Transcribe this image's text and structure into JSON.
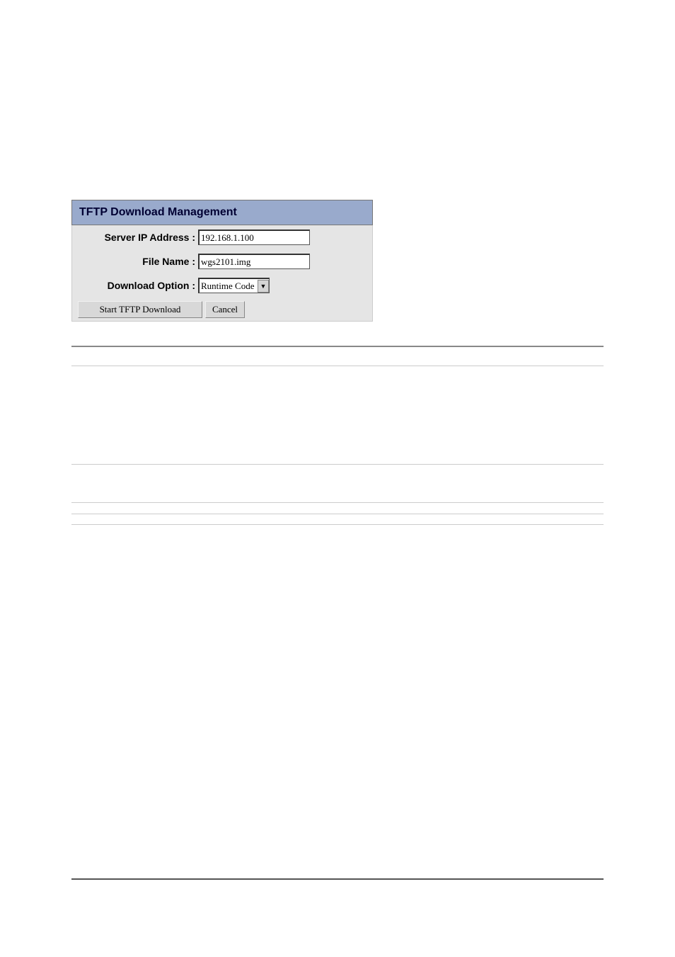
{
  "panel": {
    "title": "TFTP Download Management",
    "server_ip_label": "Server IP Address :",
    "server_ip_value": "192.168.1.100",
    "file_name_label": "File Name :",
    "file_name_value": "wgs2101.img",
    "download_option_label": "Download Option :",
    "download_option_value": "Runtime Code",
    "start_button": "Start TFTP Download",
    "cancel_button": "Cancel"
  }
}
